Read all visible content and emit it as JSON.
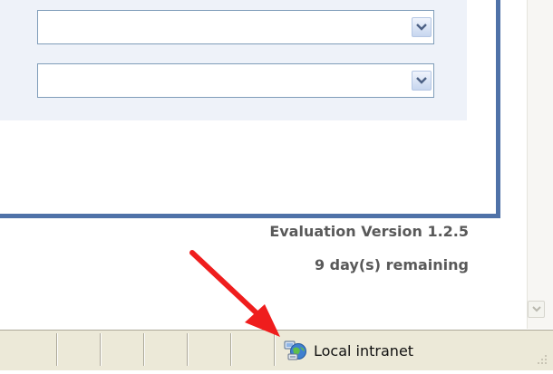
{
  "form": {
    "dropdowns": [
      {
        "value": ""
      },
      {
        "value": ""
      }
    ]
  },
  "evaluation": {
    "version_text": "Evaluation Version 1.2.5",
    "remaining_text": "9 day(s) remaining"
  },
  "status_bar": {
    "zone_label": "Local intranet",
    "zone_icon": "intranet-globe-icon"
  },
  "annotation": {
    "arrow_color": "#ef1d1d"
  }
}
